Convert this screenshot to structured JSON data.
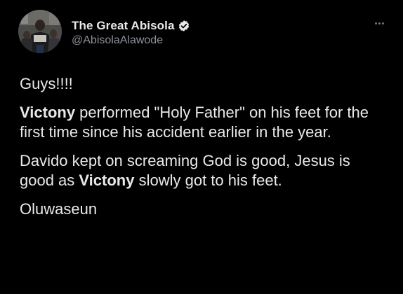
{
  "tweet": {
    "author": {
      "display_name": "The Great Abisola",
      "handle": "@AbisolaAlawode",
      "verified": true,
      "avatar_icon": "avatar-photo"
    },
    "menu_icon": "more-options-icon",
    "paragraphs": {
      "p1": "Guys!!!!",
      "p2_bold": "Victony",
      "p2_rest": " performed \"Holy Father\" on his feet for the first time since his accident earlier in the year.",
      "p3_start": "Davido kept on screaming God is good, Jesus is good as ",
      "p3_bold": "Victony",
      "p3_end": " slowly got to his feet.",
      "p4": "Oluwaseun"
    }
  },
  "colors": {
    "background": "#000000",
    "text": "#e7e9ea",
    "secondary_text": "#8b9096",
    "verified_badge": "#1d9bf0"
  }
}
